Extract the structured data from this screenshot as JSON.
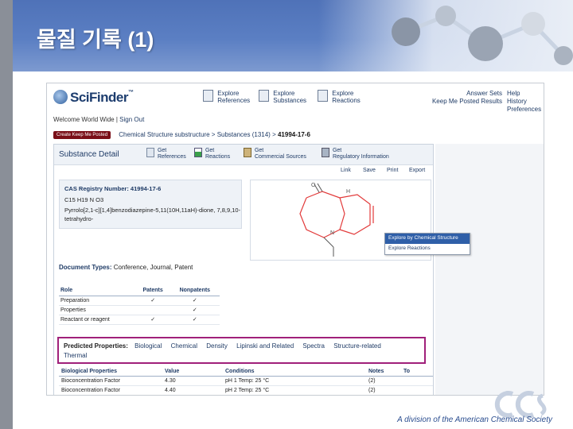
{
  "slide": {
    "title": "물질 기록 (1)",
    "footer": "A division of the American Chemical Society"
  },
  "scifinder": {
    "logo": "SciFinder",
    "nav": [
      {
        "line1": "Explore",
        "line2": "References"
      },
      {
        "line1": "Explore",
        "line2": "Substances"
      },
      {
        "line1": "Explore",
        "line2": "Reactions"
      }
    ],
    "toplinks_left": [
      "Answer Sets",
      "Keep Me Posted Results"
    ],
    "toplinks_right": [
      "Help",
      "History",
      "Preferences"
    ],
    "welcome": "Welcome World Wide",
    "signout": "Sign Out",
    "keep_button": "Create Keep Me Posted",
    "breadcrumb": {
      "crumb1": "Chemical Structure substructure >",
      "crumb2": "Substances (1314) >",
      "current": "41994-17-6"
    }
  },
  "detail": {
    "title": "Substance Detail",
    "tools": [
      {
        "line1": "Get",
        "line2": "References"
      },
      {
        "line1": "Get",
        "line2": "Reactions"
      },
      {
        "line1": "Get",
        "line2": "Commercial Sources"
      },
      {
        "line1": "Get",
        "line2": "Regulatory Information"
      }
    ],
    "actions": [
      "Link",
      "Save",
      "Print",
      "Export"
    ],
    "registry": {
      "label": "CAS Registry Number: 41994-17-6",
      "formula": "C15 H19 N O3",
      "name_line1": "Pyrrolo[2,1-c][1,4]benzodiazepine-5,11(10H,11aH)-dione, 7,8,9,10-",
      "name_line2": "tetrahydro-"
    },
    "context_menu": [
      "Explore by Chemical Structure",
      "Explore Reactions"
    ],
    "doc_types_label": "Document Types:",
    "doc_types": "Conference,  Journal,  Patent",
    "roles": {
      "headers": [
        "Role",
        "Patents",
        "Nonpatents"
      ],
      "rows": [
        {
          "role": "Preparation",
          "patents": "✓",
          "nonpatents": "✓"
        },
        {
          "role": "Properties",
          "patents": "",
          "nonpatents": "✓"
        },
        {
          "role": "Reactant or reagent",
          "patents": "✓",
          "nonpatents": "✓"
        }
      ]
    },
    "predicted": {
      "label": "Predicted Properties:",
      "options": [
        "Biological",
        "Chemical",
        "Density",
        "Lipinski and Related",
        "Spectra",
        "Structure-related"
      ],
      "option2": "Thermal"
    },
    "bio": {
      "headers": [
        "Biological Properties",
        "Value",
        "Conditions",
        "Notes",
        "To"
      ],
      "rows": [
        {
          "prop": "Bioconcentration Factor",
          "value": "4.30",
          "cond": "pH 1  Temp: 25 °C",
          "notes": "(2)"
        },
        {
          "prop": "Bioconcentration Factor",
          "value": "4.40",
          "cond": "pH 2  Temp: 25 °C",
          "notes": "(2)"
        }
      ]
    }
  }
}
